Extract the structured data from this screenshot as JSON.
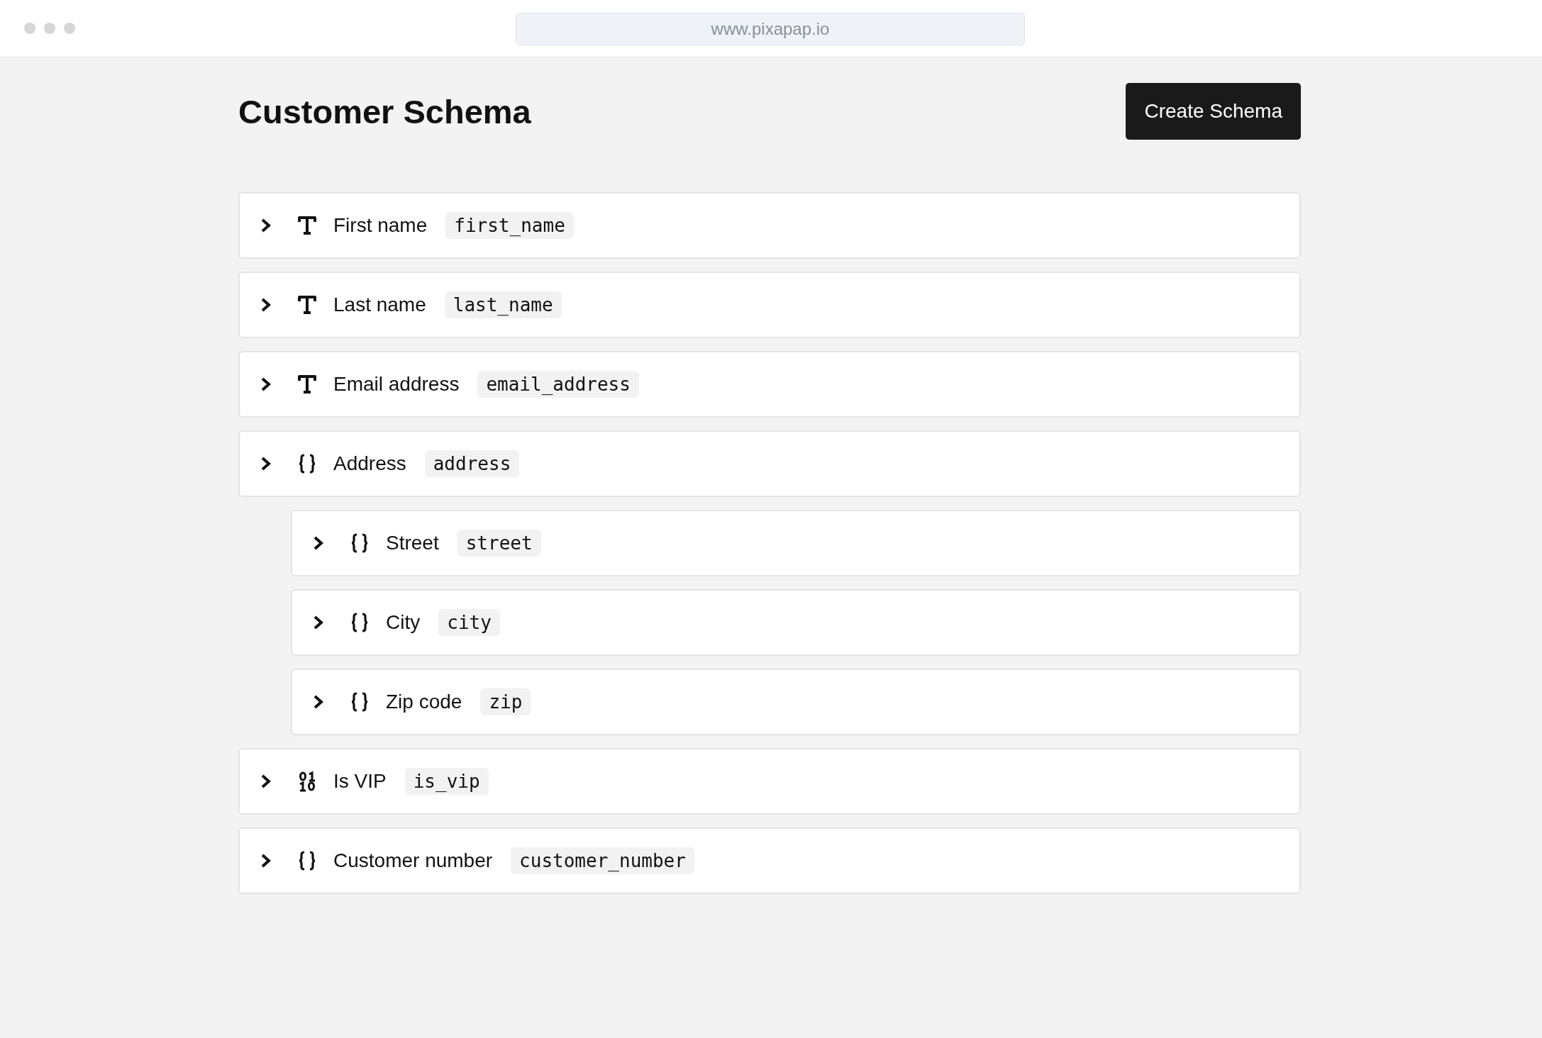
{
  "browser": {
    "url": "www.pixapap.io"
  },
  "header": {
    "title": "Customer Schema",
    "button": "Create Schema"
  },
  "fields": [
    {
      "kind": "text",
      "label": "First name",
      "key": "first_name"
    },
    {
      "kind": "text",
      "label": "Last name",
      "key": "last_name"
    },
    {
      "kind": "text",
      "label": "Email address",
      "key": "email_address"
    },
    {
      "kind": "object",
      "label": "Address",
      "key": "address",
      "children": [
        {
          "kind": "object",
          "label": "Street",
          "key": "street"
        },
        {
          "kind": "object",
          "label": "City",
          "key": "city"
        },
        {
          "kind": "object",
          "label": "Zip code",
          "key": "zip"
        }
      ]
    },
    {
      "kind": "binary",
      "label": "Is VIP",
      "key": "is_vip"
    },
    {
      "kind": "object",
      "label": "Customer number",
      "key": "customer_number"
    }
  ]
}
